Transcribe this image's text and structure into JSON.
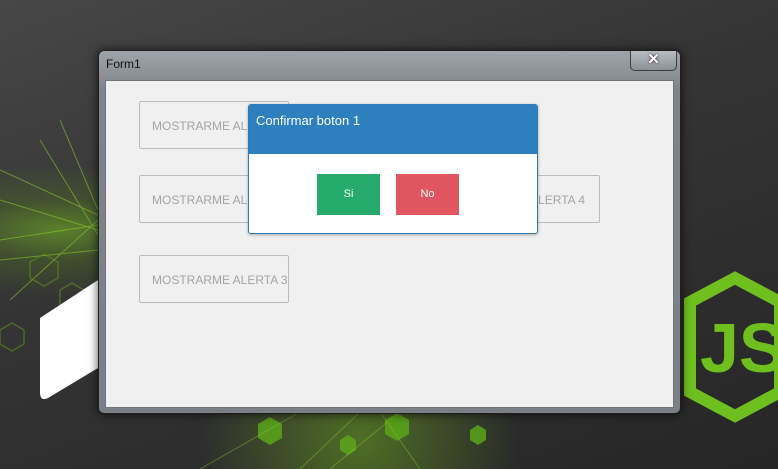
{
  "window": {
    "title": "Form1",
    "close_glyph": "✕"
  },
  "form": {
    "buttons": [
      {
        "label": "MOSTRARME ALERTA 1"
      },
      {
        "label": "MOSTRARME ALERTA 2"
      },
      {
        "label": "MOSTRARME ALERTA 3"
      },
      {
        "label": "ALERTA 4"
      }
    ]
  },
  "dialog": {
    "title": "Confirmar boton 1",
    "yes_label": "Si",
    "no_label": "No"
  },
  "colors": {
    "dialog_header": "#2e7fbd",
    "yes_button": "#27ab6c",
    "no_button": "#e05560",
    "nodejs_green": "#6fbf1f"
  },
  "wallpaper": {
    "logo_text": "JS"
  }
}
